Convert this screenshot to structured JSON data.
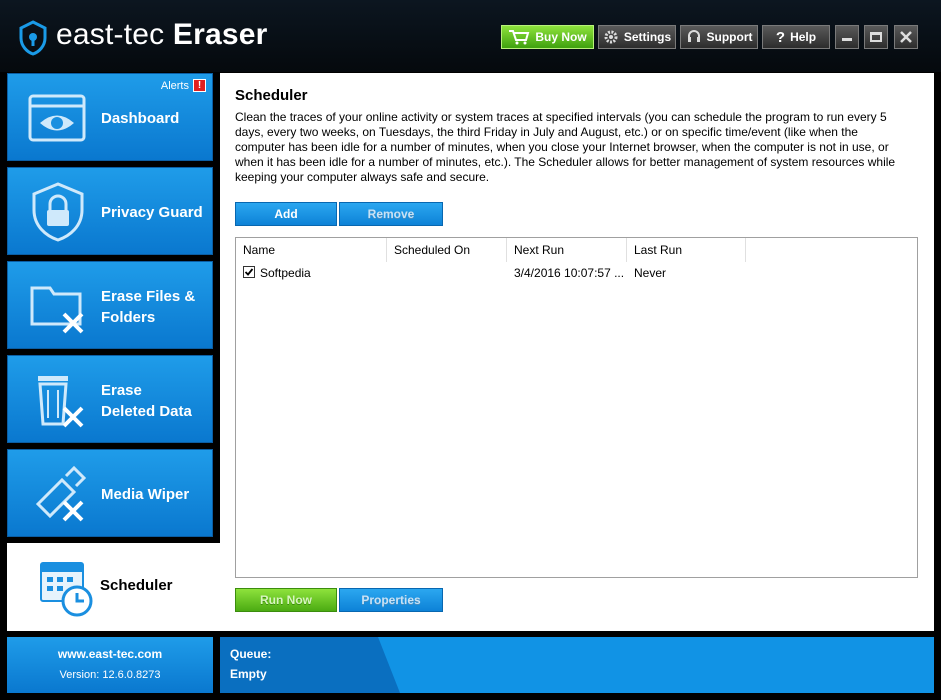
{
  "app": {
    "title_light": "east-tec ",
    "title_bold": "Eraser"
  },
  "toolbar": {
    "buy_now": "Buy Now",
    "settings": "Settings",
    "support": "Support",
    "help": "Help"
  },
  "sidebar": {
    "alerts_label": "Alerts",
    "alerts_badge": "!",
    "items": [
      {
        "label": "Dashboard"
      },
      {
        "label": "Privacy Guard"
      },
      {
        "label_line1": "Erase Files &",
        "label_line2": "Folders"
      },
      {
        "label_line1": "Erase",
        "label_line2": "Deleted Data"
      },
      {
        "label": "Media Wiper"
      },
      {
        "label": "Scheduler"
      }
    ]
  },
  "content": {
    "title": "Scheduler",
    "description": "Clean the traces of your online activity or system traces at specified intervals (you can schedule the program to run every 5 days, every two weeks, on Tuesdays, the third Friday in July and August, etc.) or on specific time/event (like when the computer has been idle for a number of minutes, when you close your Internet browser, when the computer is not in use, or when it has been idle for a number of minutes, etc.). The Scheduler allows for better management of system resources while keeping your computer always safe and secure.",
    "add_label": "Add",
    "remove_label": "Remove",
    "columns": [
      "Name",
      "Scheduled On",
      "Next Run",
      "Last Run"
    ],
    "rows": [
      {
        "name": "Softpedia",
        "scheduled_on": "",
        "next_run": "3/4/2016 10:07:57 ...",
        "last_run": "Never",
        "checked": true
      }
    ],
    "run_now_label": "Run Now",
    "properties_label": "Properties"
  },
  "footer": {
    "website": "www.east-tec.com",
    "version": "Version: 12.6.0.8273",
    "queue_label": "Queue:",
    "queue_value": "Empty"
  },
  "colors": {
    "tile_blue": "#1a8fe0",
    "buy_green": "#5cc21e",
    "title_bar": "#0a1016"
  }
}
